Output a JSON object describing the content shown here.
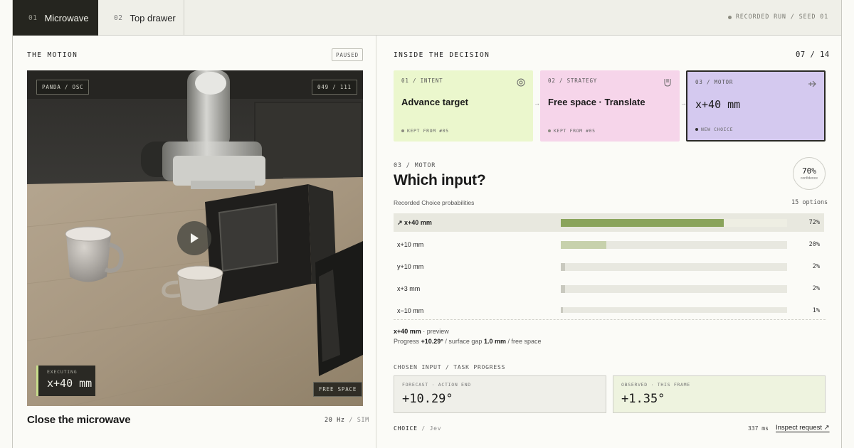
{
  "tabs": [
    {
      "num": "01",
      "label": "Microwave",
      "active": true
    },
    {
      "num": "02",
      "label": "Top drawer",
      "active": false
    }
  ],
  "run_info": "RECORDED RUN / SEED 01",
  "left": {
    "title": "THE MOTION",
    "status_badge": "PAUSED",
    "scene": {
      "robot_label": "PANDA / OSC",
      "frame_counter": "049 / 111",
      "executing_label": "EXECUTING",
      "executing_value": "x+40 mm",
      "region_badge": "FREE SPACE",
      "play_icon": "play-icon"
    },
    "task_title": "Close the microwave",
    "rate": "20 Hz",
    "rate_sep": "/",
    "mode": "SIM"
  },
  "right": {
    "title": "INSIDE THE DECISION",
    "step": "07 / 14",
    "cards": [
      {
        "label": "01 / INTENT",
        "title": "Advance target",
        "footer": "KEPT FROM #05",
        "icon": "target-icon",
        "color": "#ebf7cd"
      },
      {
        "label": "02 / STRATEGY",
        "title": "Free space · Translate",
        "footer": "KEPT FROM #05",
        "icon": "magnet-icon",
        "color": "#f6d5ea"
      },
      {
        "label": "03 / MOTOR",
        "title": "x+40 mm",
        "footer": "NEW CHOICE",
        "icon": "arrow-right-icon",
        "color": "#d4c9ef"
      }
    ],
    "section_label": "03 / MOTOR",
    "question": "Which input?",
    "confidence": {
      "value": "70%",
      "label": "confidence",
      "fraction": 0.7
    },
    "probs_label": "Recorded Choice probabilities",
    "options_count": "15 options",
    "options": [
      {
        "label": "↗ x+40 mm",
        "pct": "72%",
        "value": 0.72,
        "selected": true
      },
      {
        "label": "x+10 mm",
        "pct": "20%",
        "value": 0.2,
        "selected": false
      },
      {
        "label": "y+10 mm",
        "pct": "2%",
        "value": 0.02,
        "selected": false
      },
      {
        "label": "x+3 mm",
        "pct": "2%",
        "value": 0.02,
        "selected": false
      },
      {
        "label": "x−10 mm",
        "pct": "1%",
        "value": 0.01,
        "selected": false
      }
    ],
    "preview": {
      "option": "x+40 mm",
      "suffix": " · preview"
    },
    "progress": {
      "prefix": "Progress ",
      "angle": "+10.29°",
      "mid": " / surface gap ",
      "gap": "1.0 mm",
      "suffix": " / free space"
    },
    "chosen_label": "CHOSEN INPUT / TASK PROGRESS",
    "forecast": {
      "label": "FORECAST · ACTION END",
      "value": "+10.29°"
    },
    "observed": {
      "label": "OBSERVED · THIS FRAME",
      "value": "+1.35°"
    },
    "choice_label": "CHOICE",
    "choice_sep": " / ",
    "choice_sub": "Jev",
    "latency": "337 ms",
    "inspect_link": "Inspect request ↗"
  },
  "colors": {
    "selected_fill": "#8aa45b",
    "secondary_fill": "#c7d1ac",
    "minor_fill": "#c9c9bf",
    "intent_card": "#ebf7cd",
    "strategy_card": "#f6d5ea",
    "motor_card": "#d4c9ef",
    "forecast_box": "#efefe9",
    "observed_box": "#eef3df"
  }
}
